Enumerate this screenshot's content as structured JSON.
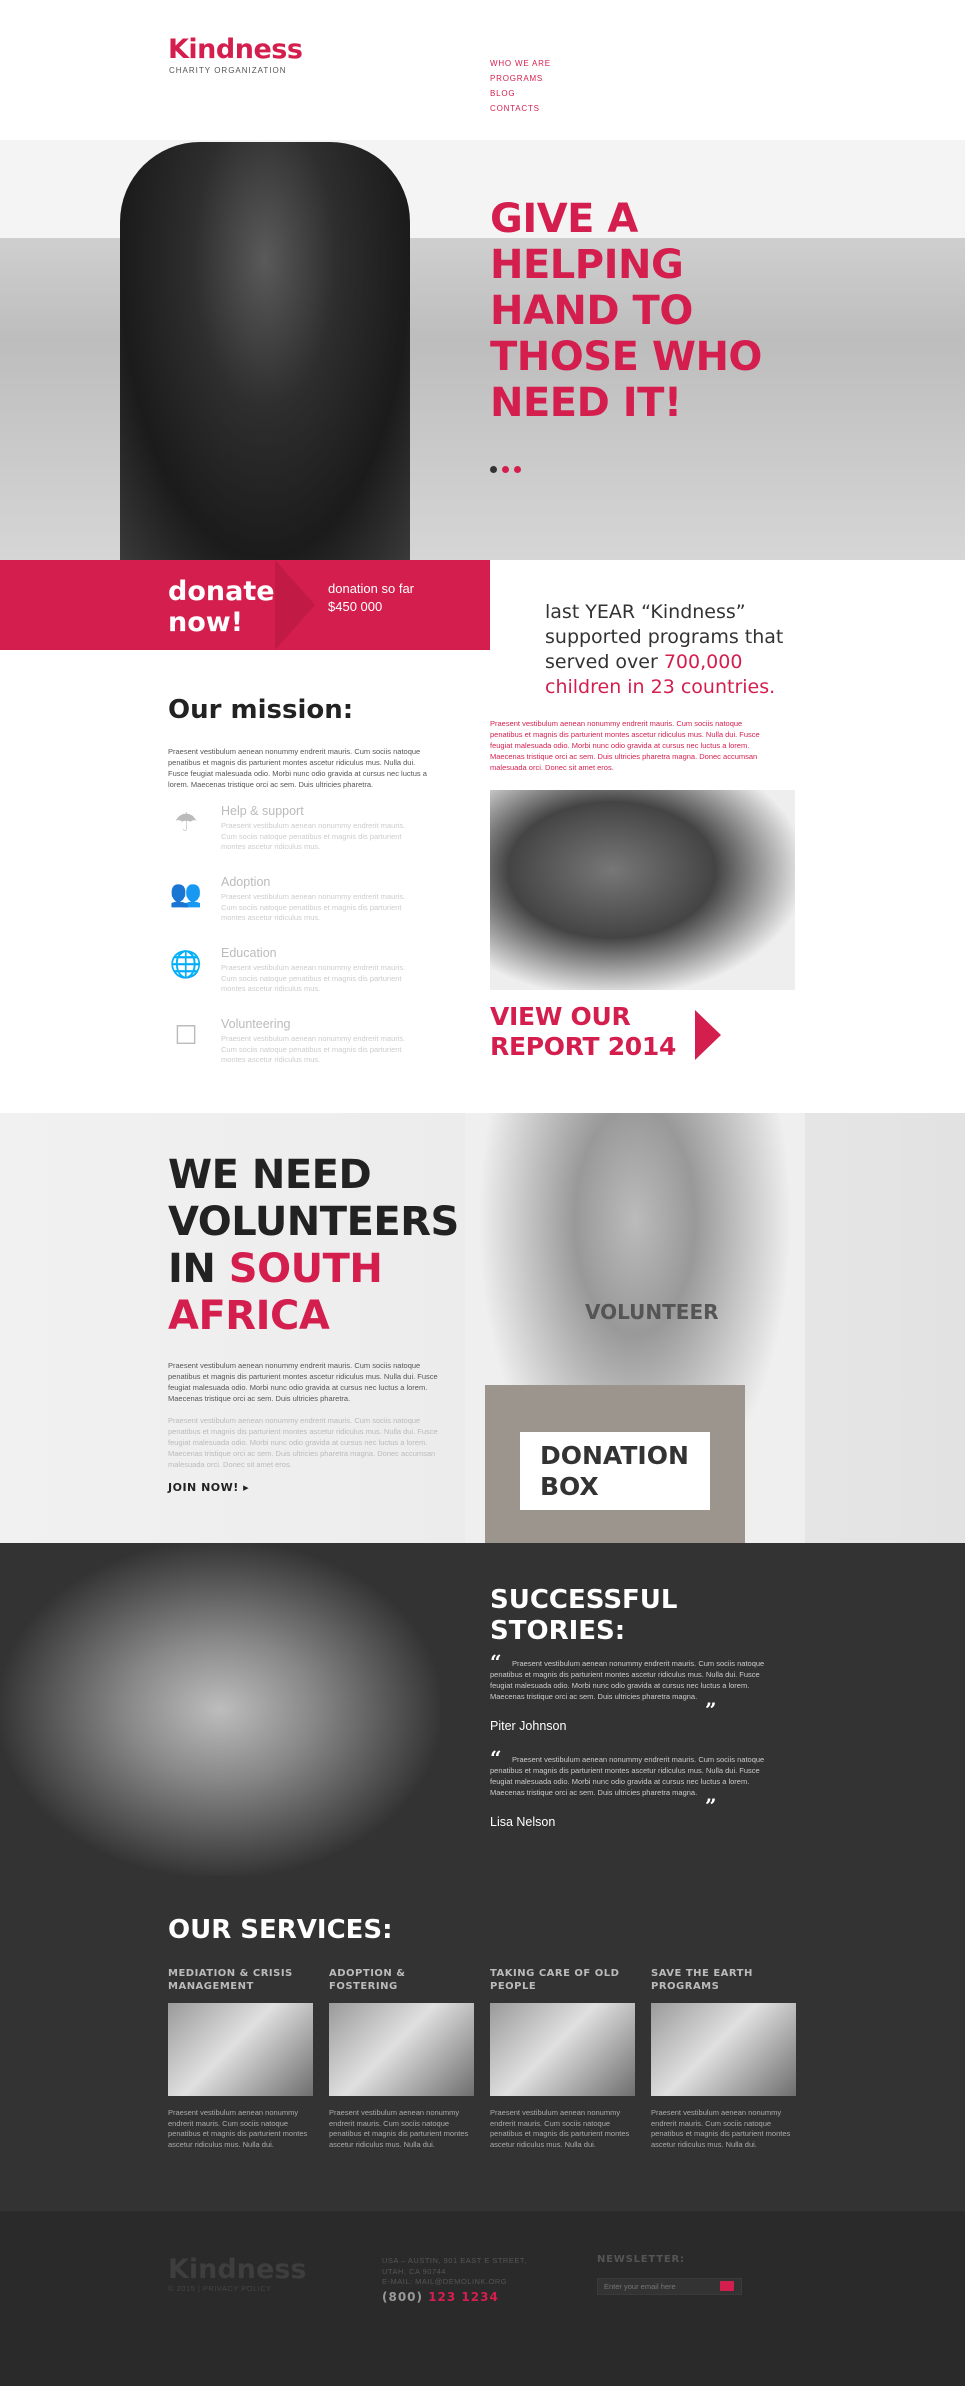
{
  "header": {
    "logo": "Kindness",
    "logo_sub": "CHARITY ORGANIZATION",
    "nav": [
      "WHO WE ARE",
      "PROGRAMS",
      "BLOG",
      "CONTACTS"
    ]
  },
  "hero": {
    "title": "GIVE A HELPING HAND TO THOSE WHO NEED IT!",
    "slides": 3,
    "active_slide": 1
  },
  "donate": {
    "label": "donate now!",
    "sub": "donation so far",
    "amount": "$450 000"
  },
  "stat": {
    "line1": "last YEAR “Kindness” supported programs that served over ",
    "highlight": "700,000 children in 23 countries."
  },
  "lorem_pink": "Praesent vestibulum aenean nonummy endrerit mauris. Cum sociis natoque penatibus et magnis dis parturient montes ascetur ridiculus mus. Nulla dui. Fusce feugiat malesuada odio. Morbi nunc odio gravida at cursus nec luctus a lorem. Maecenas tristique orci ac sem. Duis ultricies pharetra magna. Donec accumsan malesuada orci. Donec sit amet eros.",
  "mission": {
    "title": "Our mission:",
    "text": "Praesent vestibulum aenean nonummy endrerit mauris. Cum sociis natoque penatibus et magnis dis parturient montes ascetur ridiculus mus. Nulla dui. Fusce feugiat malesuada odio. Morbi nunc odio gravida at cursus nec luctus a lorem. Maecenas tristique orci ac sem. Duis ultricies pharetra.",
    "items": [
      {
        "title": "Help & support",
        "icon": "umbrella-icon",
        "text": "Praesent vestibulum aenean nonummy endrerit mauris. Cum sociis natoque penatibus et magnis dis parturient montes ascetur ridiculus mus."
      },
      {
        "title": "Adoption",
        "icon": "people-icon",
        "text": "Praesent vestibulum aenean nonummy endrerit mauris. Cum sociis natoque penatibus et magnis dis parturient montes ascetur ridiculus mus."
      },
      {
        "title": "Education",
        "icon": "globe-icon",
        "text": "Praesent vestibulum aenean nonummy endrerit mauris. Cum sociis natoque penatibus et magnis dis parturient montes ascetur ridiculus mus."
      },
      {
        "title": "Volunteering",
        "icon": "box-icon",
        "text": "Praesent vestibulum aenean nonummy endrerit mauris. Cum sociis natoque penatibus et magnis dis parturient montes ascetur ridiculus mus."
      }
    ]
  },
  "report": {
    "label": "VIEW OUR REPORT 2014"
  },
  "volunteers": {
    "title_dark": "WE NEED VOLUNTEERS IN ",
    "title_pink": "SOUTH AFRICA",
    "p1": "Praesent vestibulum aenean nonummy endrerit mauris. Cum sociis natoque penatibus et magnis dis parturient montes ascetur ridiculus mus. Nulla dui. Fusce feugiat malesuada odio. Morbi nunc odio gravida at cursus nec luctus a lorem. Maecenas tristique orci ac sem. Duis ultricies pharetra.",
    "p2": "Praesent vestibulum aenean nonummy endrerit mauris. Cum sociis natoque penatibus et magnis dis parturient montes ascetur ridiculus mus. Nulla dui. Fusce feugiat malesuada odio. Morbi nunc odio gravida at cursus nec luctus a lorem. Maecenas tristique orci ac sem. Duis ultricies pharetra magna. Donec accumsan malesuada orci. Donec sit amet eros.",
    "join": "JOIN NOW!",
    "shirt": "VOLUNTEER",
    "box": "DONATION BOX"
  },
  "stories": {
    "title": "SUCCESSFUL STORIES:",
    "quotes": [
      {
        "text": "Praesent vestibulum aenean nonummy endrerit mauris. Cum sociis natoque penatibus et magnis dis parturient montes ascetur ridiculus mus. Nulla dui. Fusce feugiat malesuada odio. Morbi nunc odio gravida at cursus nec luctus a lorem. Maecenas tristique orci ac sem. Duis ultricies pharetra magna.",
        "name": "Piter Johnson"
      },
      {
        "text": "Praesent vestibulum aenean nonummy endrerit mauris. Cum sociis natoque penatibus et magnis dis parturient montes ascetur ridiculus mus. Nulla dui. Fusce feugiat malesuada odio. Morbi nunc odio gravida at cursus nec luctus a lorem. Maecenas tristique orci ac sem. Duis ultricies pharetra magna.",
        "name": "Lisa Nelson"
      }
    ]
  },
  "services": {
    "title": "OUR SERVICES:",
    "items": [
      {
        "title": "MEDIATION & CRISIS MANAGEMENT",
        "text": "Praesent vestibulum aenean nonummy endrerit mauris. Cum sociis natoque penatibus et magnis dis parturient montes ascetur ridiculus mus. Nulla dui."
      },
      {
        "title": "ADOPTION & FOSTERING",
        "text": "Praesent vestibulum aenean nonummy endrerit mauris. Cum sociis natoque penatibus et magnis dis parturient montes ascetur ridiculus mus. Nulla dui."
      },
      {
        "title": "TAKING CARE OF OLD PEOPLE",
        "text": "Praesent vestibulum aenean nonummy endrerit mauris. Cum sociis natoque penatibus et magnis dis parturient montes ascetur ridiculus mus. Nulla dui."
      },
      {
        "title": "SAVE THE EARTH PROGRAMS",
        "text": "Praesent vestibulum aenean nonummy endrerit mauris. Cum sociis natoque penatibus et magnis dis parturient montes ascetur ridiculus mus. Nulla dui."
      }
    ]
  },
  "footer": {
    "logo": "Kindness",
    "copyright": "© 2015 | PRIVACY POLICY",
    "address1": "USA – AUSTIN, 901 EAST E STREET,",
    "address2": "UTAH, CA 90744",
    "email": "E-MAIL: MAIL@DEMOLINK.ORG",
    "phone_prefix": "(800) ",
    "phone": "123 1234",
    "newsletter": "NEWSLETTER:",
    "placeholder": "Enter your email here"
  },
  "colors": {
    "accent": "#d41f4e",
    "dark": "#333333",
    "footer": "#2a2a2a"
  }
}
